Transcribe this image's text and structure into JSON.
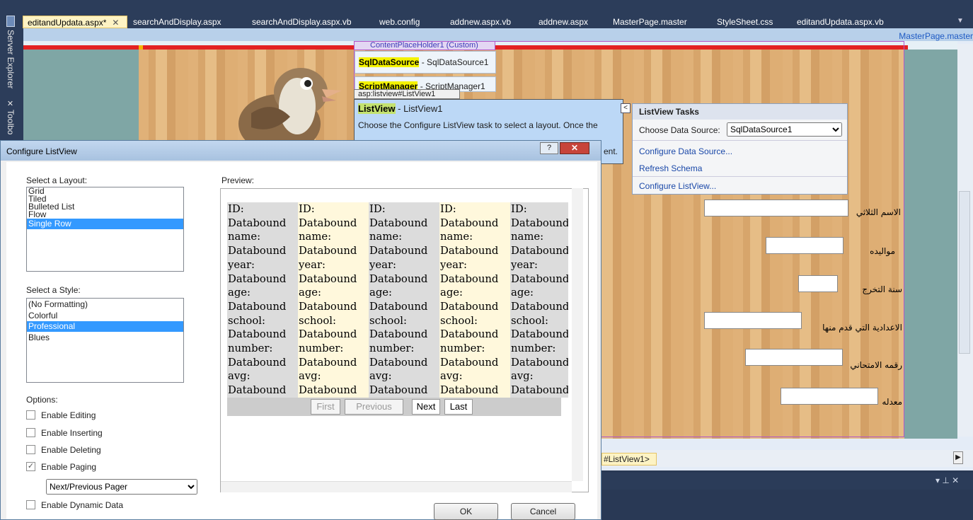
{
  "tabs": [
    {
      "label": "editandUpdata.aspx*",
      "active": true
    },
    {
      "label": "searchAndDisplay.aspx"
    },
    {
      "label": "searchAndDisplay.aspx.vb"
    },
    {
      "label": "web.config"
    },
    {
      "label": "addnew.aspx.vb"
    },
    {
      "label": "addnew.aspx"
    },
    {
      "label": "MasterPage.master"
    },
    {
      "label": "StyleSheet.css"
    },
    {
      "label": "editandUpdata.aspx.vb"
    }
  ],
  "side_tabs": {
    "server_explorer": "Server Explorer",
    "toolbox": "Toolbo"
  },
  "master_link": "MasterPage.master",
  "designer": {
    "content_placeholder": "ContentPlaceHolder1 (Custom)",
    "sqldatasource": {
      "name": "SqlDataSource",
      "id": " - SqlDataSource1"
    },
    "scriptmanager": {
      "name": "ScriptManager",
      "id": " - ScriptManager1"
    },
    "lv_tag": "asp:listview#ListView1",
    "listview": {
      "name": "ListView",
      "id": " - ListView1",
      "desc_line1": "Choose the Configure ListView task to select a layout. Once the",
      "desc_tail": "ent."
    },
    "status_tag": "#ListView1>"
  },
  "tasks_panel": {
    "title": "ListView Tasks",
    "choose_label": "Choose Data Source:",
    "choose_value": "SqlDataSource1",
    "links": [
      "Configure Data Source...",
      "Refresh Schema",
      "Configure ListView..."
    ]
  },
  "form_labels": [
    "الاسم الثلاثي",
    "مواليده",
    "سنة التخرج",
    "الاعدادية التي قدم منها",
    "رقمه الامتحاني",
    "معدله"
  ],
  "dialog": {
    "title": "Configure ListView",
    "help": "?",
    "select_layout_label": "Select a Layout:",
    "layouts": [
      "Grid",
      "Tiled",
      "Bulleted List",
      "Flow",
      "Single Row"
    ],
    "selected_layout": "Single Row",
    "select_style_label": "Select a Style:",
    "styles": [
      "(No Formatting)",
      "Colorful",
      "Professional",
      "Blues"
    ],
    "selected_style": "Professional",
    "options_label": "Options:",
    "options": [
      {
        "label": "Enable Editing",
        "checked": false
      },
      {
        "label": "Enable Inserting",
        "checked": false
      },
      {
        "label": "Enable Deleting",
        "checked": false
      },
      {
        "label": "Enable Paging",
        "checked": true
      }
    ],
    "pager_value": "Next/Previous Pager",
    "dynamic_data": {
      "label": "Enable Dynamic Data",
      "checked": false
    },
    "preview_label": "Preview:",
    "preview_lines": [
      "ID:",
      "Databound",
      "name:",
      "Databound",
      "year:",
      "Databound",
      "age:",
      "Databound",
      "school:",
      "Databound",
      "number:",
      "Databound",
      "avg:",
      "Databound"
    ],
    "pager_buttons": {
      "first": "First",
      "previous": "Previous",
      "next": "Next",
      "last": "Last"
    },
    "ok": "OK",
    "cancel": "Cancel"
  }
}
